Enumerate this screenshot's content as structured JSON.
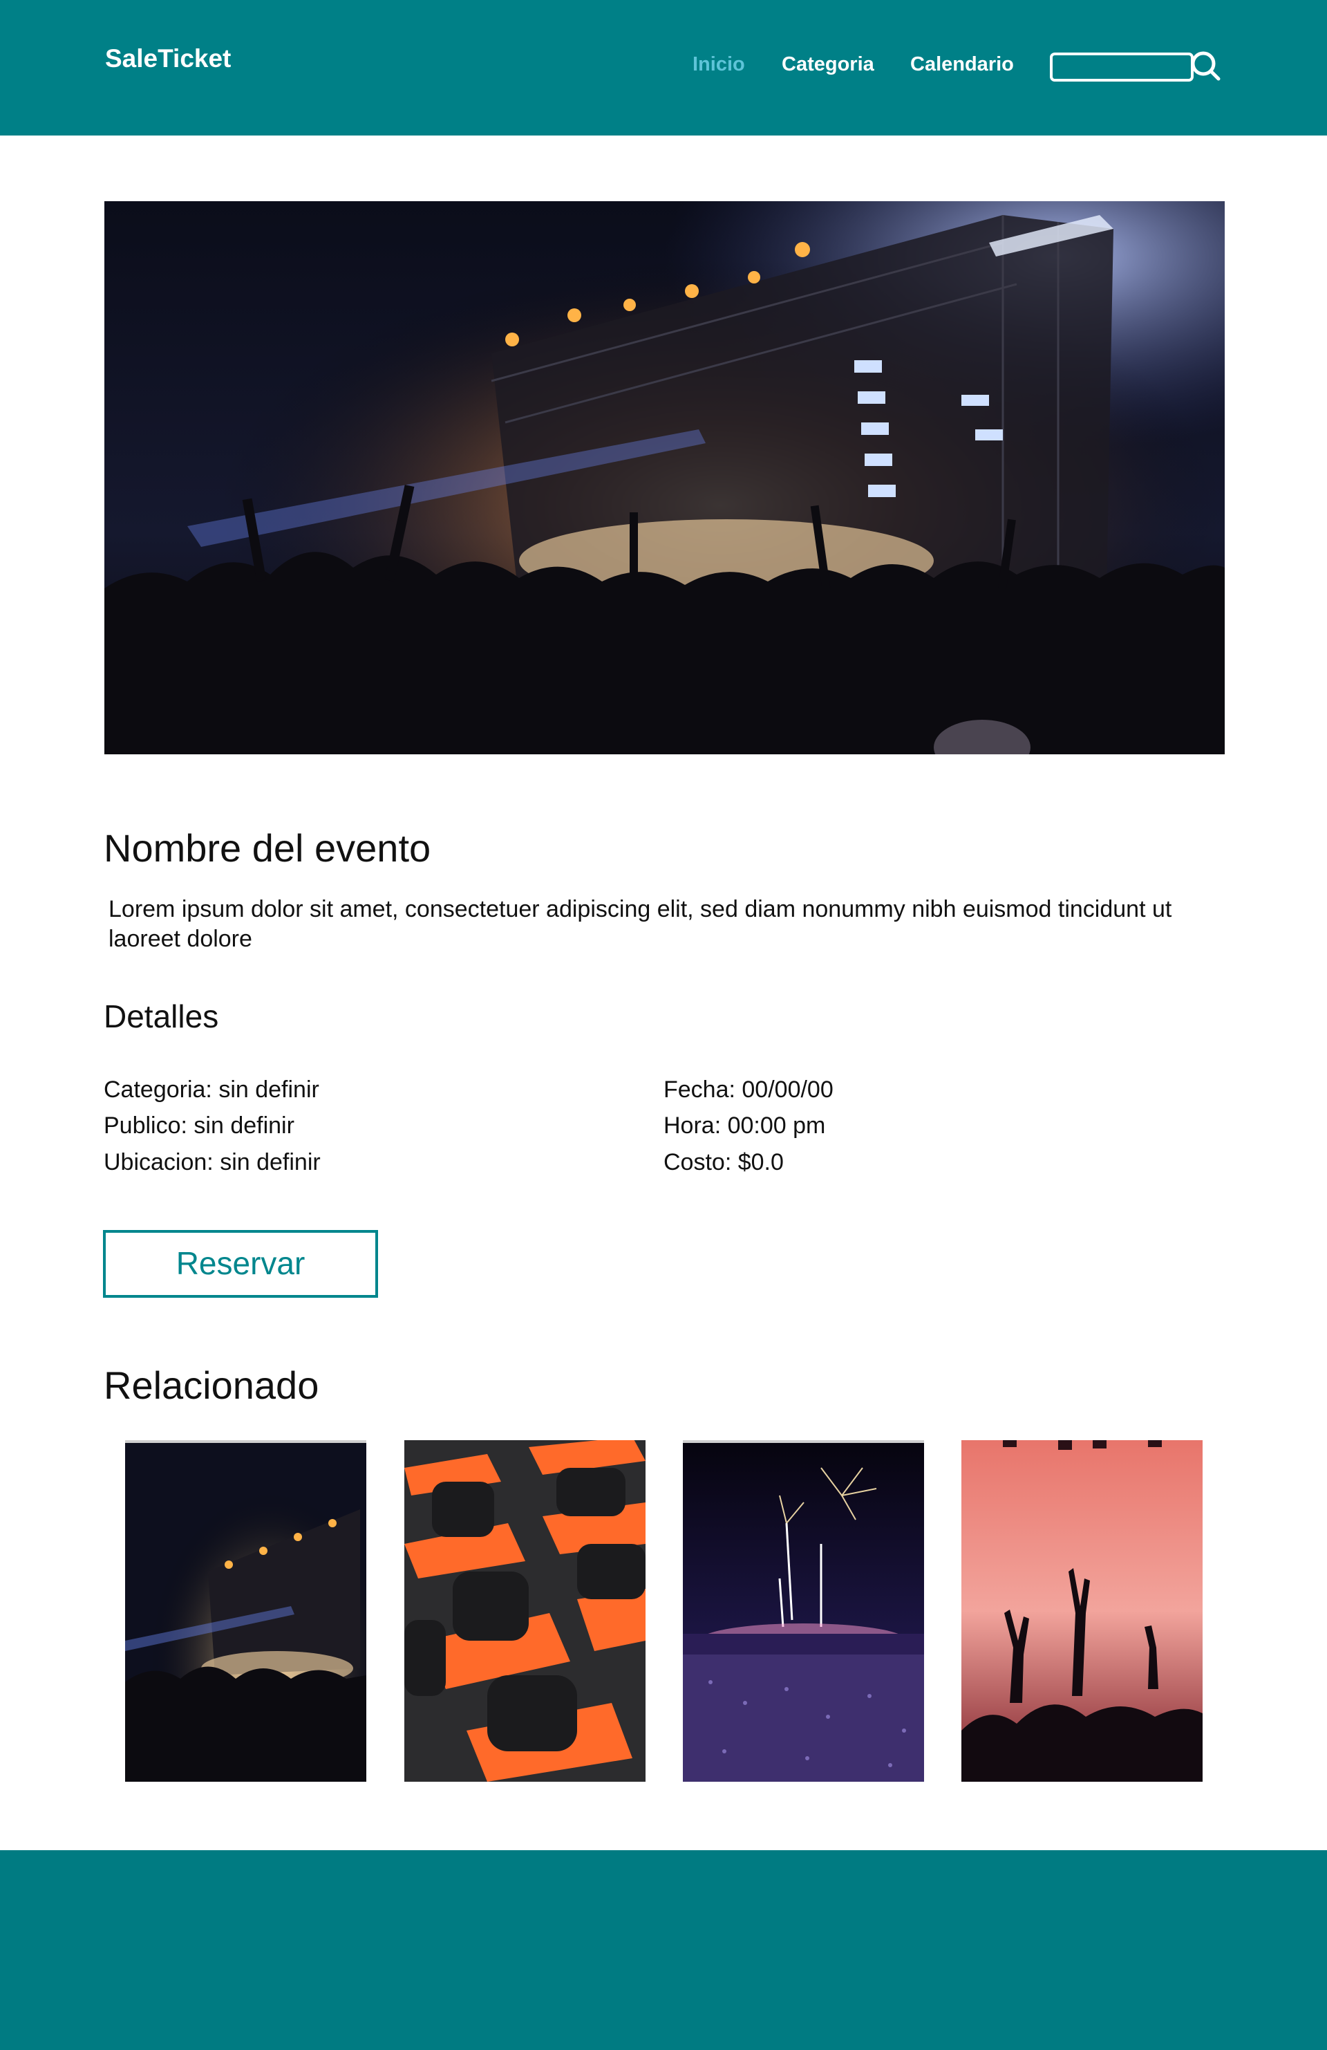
{
  "header": {
    "brand": "SaleTicket",
    "nav": [
      {
        "label": "Inicio",
        "active": true
      },
      {
        "label": "Categoria",
        "active": false
      },
      {
        "label": "Calendario",
        "active": false
      }
    ],
    "search": {
      "icon": "search-icon",
      "placeholder": ""
    }
  },
  "event": {
    "title": "Nombre del evento",
    "description": "Lorem ipsum dolor sit amet, consectetuer adipiscing elit, sed diam nonummy nibh euismod tincidunt ut laoreet dolore"
  },
  "details": {
    "title": "Detalles",
    "left": [
      "Categoria: sin definir",
      "Publico: sin definir",
      "Ubicacion: sin definir"
    ],
    "right": [
      "Fecha: 00/00/00",
      "Hora: 00:00 pm",
      "Costo: $0.0"
    ]
  },
  "reserve_label": "Reservar",
  "related": {
    "title": "Relacionado",
    "items": [
      {
        "image": "concert-stage-photo"
      },
      {
        "image": "orange-chairs-photo"
      },
      {
        "image": "fireworks-festival-photo"
      },
      {
        "image": "crowd-hands-red-light-photo"
      }
    ]
  },
  "colors": {
    "primary": "#008087",
    "footer": "#007b82",
    "nav_active": "#5ec4d8",
    "button_border": "#00868d"
  }
}
